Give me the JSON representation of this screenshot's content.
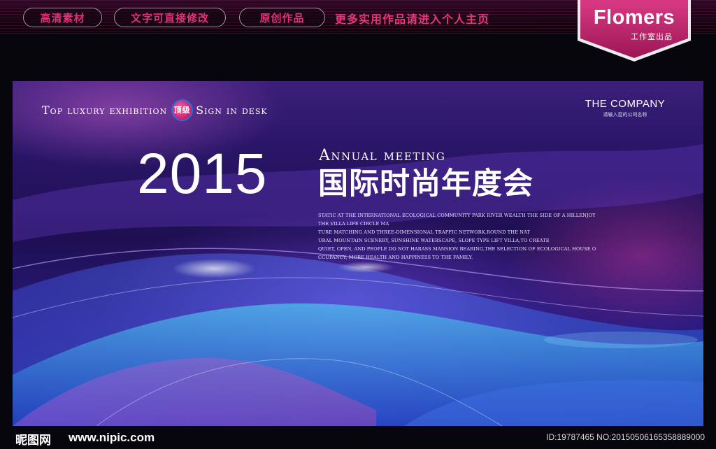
{
  "topbar": {
    "pills": [
      "高清素材",
      "文字可直接修改",
      "原创作品"
    ],
    "promo": "更多实用作品请进入个人主页",
    "badge_title": "Flomers",
    "badge_subtitle": "工作室出品"
  },
  "banner": {
    "tagline_before": "Top luxury exhibition",
    "tagline_badge": "顶级",
    "tagline_after": "Sign in desk",
    "company_name": "THE COMPANY",
    "company_subtitle": "请输入您的公司名称",
    "year": "2015",
    "annual": "Annual meeting",
    "cn_title": "国际时尚年度会",
    "body_lines": [
      "STATIC AT THE INTERNATIONAL ECOLOGICAL COMMUNITY PARK RIVER WEALTH THE SIDE OF A HILLENJOY",
      "THE VILLA LIFE CIRCLE MA",
      "TURE MATCHING AND THREE-DIMENSIONAL TRAFFIC NETWORK,ROUND THE NAT",
      "URAL MOUNTAIN SCENERY, SUNSHINE WATERSCAPE, SLOPE TYPE LIFT VILLA,TO CREATE",
      "QUIET, OPEN, AND PEOPLE DO NOT HARASS MANSION BEARING,THE SELECTION OF ECOLOGICAL HOUSE O",
      "CCUPANCY, MORE HEALTH AND HAPPINESS TO THE FAMILY."
    ]
  },
  "footer": {
    "logo": "昵图网",
    "url": "www.nipic.com",
    "id_text": "ID:19787465 NO:20150506165358889000"
  },
  "colors": {
    "accent_pink": "#e8357c",
    "badge_magenta": "#c0246a"
  }
}
